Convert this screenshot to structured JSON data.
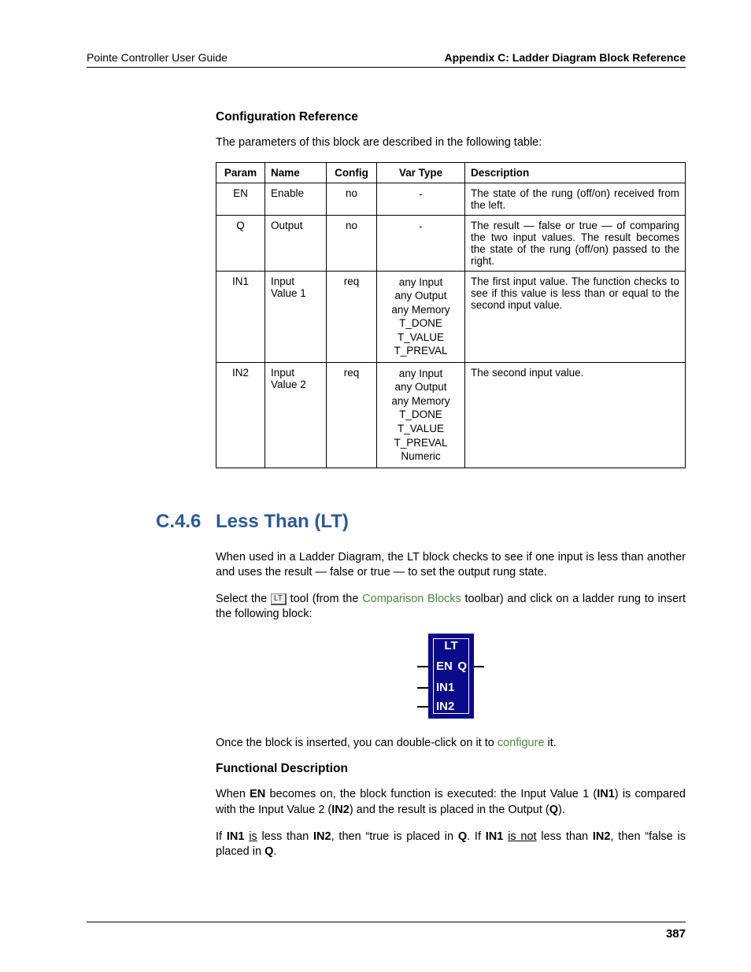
{
  "header": {
    "left": "Pointe Controller User Guide",
    "right": "Appendix C: Ladder Diagram Block Reference"
  },
  "config_ref": {
    "heading": "Configuration Reference",
    "intro": "The parameters of this block are described in the following table:",
    "columns": [
      "Param",
      "Name",
      "Config",
      "Var Type",
      "Description"
    ],
    "rows": [
      {
        "param": "EN",
        "name": "Enable",
        "config": "no",
        "vartype": [
          "-"
        ],
        "desc": "The state of the rung (off/on) received from the left."
      },
      {
        "param": "Q",
        "name": "Output",
        "config": "no",
        "vartype": [
          "-"
        ],
        "desc": "The result — false or true — of comparing the two input values. The result becomes the state of the rung (off/on) passed to the right."
      },
      {
        "param": "IN1",
        "name": "Input Value 1",
        "config": "req",
        "vartype": [
          "any Input",
          "any Output",
          "any Memory",
          "T_DONE",
          "T_VALUE",
          "T_PREVAL"
        ],
        "desc": "The first input value. The function checks to see if this value is less than or equal to the second input value."
      },
      {
        "param": "IN2",
        "name": "Input Value 2",
        "config": "req",
        "vartype": [
          "any Input",
          "any Output",
          "any Memory",
          "T_DONE",
          "T_VALUE",
          "T_PREVAL",
          "Numeric"
        ],
        "desc": "The second input value."
      }
    ]
  },
  "section": {
    "number": "C.4.6",
    "title": "Less Than (LT)",
    "para1": "When used in a Ladder Diagram, the LT block checks to see if one input is less than another and uses the result — false or true — to set the output rung state.",
    "para2_a": "Select the ",
    "tool_label": "LT",
    "para2_b": " tool (from the ",
    "para2_link": "Comparison Blocks",
    "para2_c": " toolbar) and click on a ladder rung to insert the following block:",
    "block": {
      "title": "LT",
      "en": "EN",
      "q": "Q",
      "in1": "IN1",
      "in2": "IN2"
    },
    "para3_a": "Once the block is inserted, you can double-click on it to ",
    "para3_link": "configure",
    "para3_b": " it.",
    "func_heading": "Functional Description",
    "func_p1_a": "When ",
    "func_p1_en": "EN",
    "func_p1_b": " becomes on, the block function is executed: the Input Value 1  (",
    "func_p1_in1": "IN1",
    "func_p1_c": ") is compared with the Input Value 2 (",
    "func_p1_in2": "IN2",
    "func_p1_d": ") and the result is placed in the Output (",
    "func_p1_q": "Q",
    "func_p1_e": ").",
    "func_p2_a": "If ",
    "func_p2_in1a": "IN1",
    "func_p2_b": " ",
    "func_p2_is": "is",
    "func_p2_c": " less than ",
    "func_p2_in2a": "IN2",
    "func_p2_d": ", then “true is placed in ",
    "func_p2_qa": "Q",
    "func_p2_e": ". If ",
    "func_p2_in1b": "IN1",
    "func_p2_f": " ",
    "func_p2_isnot": "is not",
    "func_p2_g": " less than ",
    "func_p2_in2b": "IN2",
    "func_p2_h": ", then “false is placed in ",
    "func_p2_qb": "Q",
    "func_p2_i": "."
  },
  "footer": {
    "page": "387"
  }
}
